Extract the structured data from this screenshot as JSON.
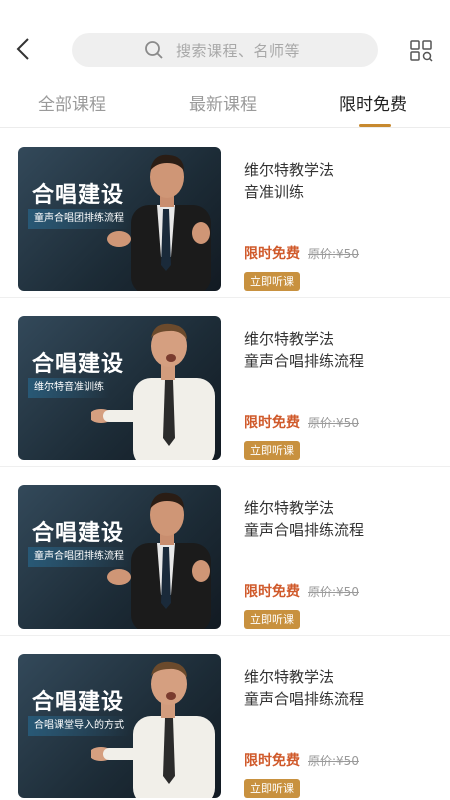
{
  "header": {
    "search_placeholder": "搜索课程、名师等"
  },
  "tabs": [
    {
      "label": "全部课程"
    },
    {
      "label": "最新课程"
    },
    {
      "label": "限时免费"
    }
  ],
  "colors": {
    "accent": "#c7892f",
    "free_text": "#d05a2b",
    "button_bg": "#c8913f"
  },
  "courses": [
    {
      "thumb_title": "合唱建设",
      "thumb_sub": "童声合唱团排练流程",
      "line1": "维尔特教学法",
      "line2": "音准训练",
      "free": "限时免费",
      "orig_price": "原价:¥50",
      "button": "立即听课"
    },
    {
      "thumb_title": "合唱建设",
      "thumb_sub": "维尔特音准训练",
      "line1": "维尔特教学法",
      "line2": "童声合唱排练流程",
      "free": "限时免费",
      "orig_price": "原价:¥50",
      "button": "立即听课"
    },
    {
      "thumb_title": "合唱建设",
      "thumb_sub": "童声合唱团排练流程",
      "line1": "维尔特教学法",
      "line2": "童声合唱排练流程",
      "free": "限时免费",
      "orig_price": "原价:¥50",
      "button": "立即听课"
    },
    {
      "thumb_title": "合唱建设",
      "thumb_sub": "合唱课堂导入的方式",
      "line1": "维尔特教学法",
      "line2": "童声合唱排练流程",
      "free": "限时免费",
      "orig_price": "原价:¥50",
      "button": "立即听课"
    }
  ]
}
